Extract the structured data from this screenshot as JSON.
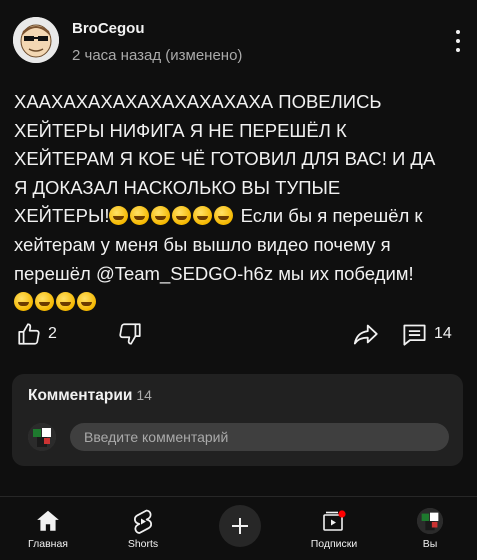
{
  "post": {
    "author": "BroCegou",
    "meta": "2 часа назад (изменено)",
    "lines": [
      "ХААХАХАХАХАХАХАХАХАХА ПОВЕЛИСЬ",
      "ХЕЙТЕРЫ НИФИГА Я НЕ ПЕРЕШЁЛ К",
      "ХЕЙТЕРАМ Я КОЕ ЧЁ ГОТОВИЛ ДЛЯ ВАС! И ДА",
      "Я ДОКАЗАЛ НАСКОЛЬКО ВЫ ТУПЫЕ"
    ],
    "line5_start": "ХЕЙТЕРЫ!",
    "line5_end": " Если бы я перешёл к",
    "line6": "хейтерам у меня бы вышло видео почему я",
    "line7": "перешёл @Team_SEDGO-h6z мы их победим!",
    "emoji_name": "rolling-on-floor-laughing"
  },
  "actions": {
    "likes": "2",
    "comments": "14"
  },
  "comments": {
    "title": "Комментарии",
    "count": "14",
    "placeholder": "Введите комментарий"
  },
  "nav": {
    "home": "Главная",
    "shorts": "Shorts",
    "subscriptions": "Подписки",
    "you": "Вы"
  },
  "colors": {
    "background": "#0f0f0f",
    "card": "#212121",
    "text": "#f1f1f1",
    "secondary_text": "#aaaaaa",
    "accent_red": "#ff0000"
  }
}
